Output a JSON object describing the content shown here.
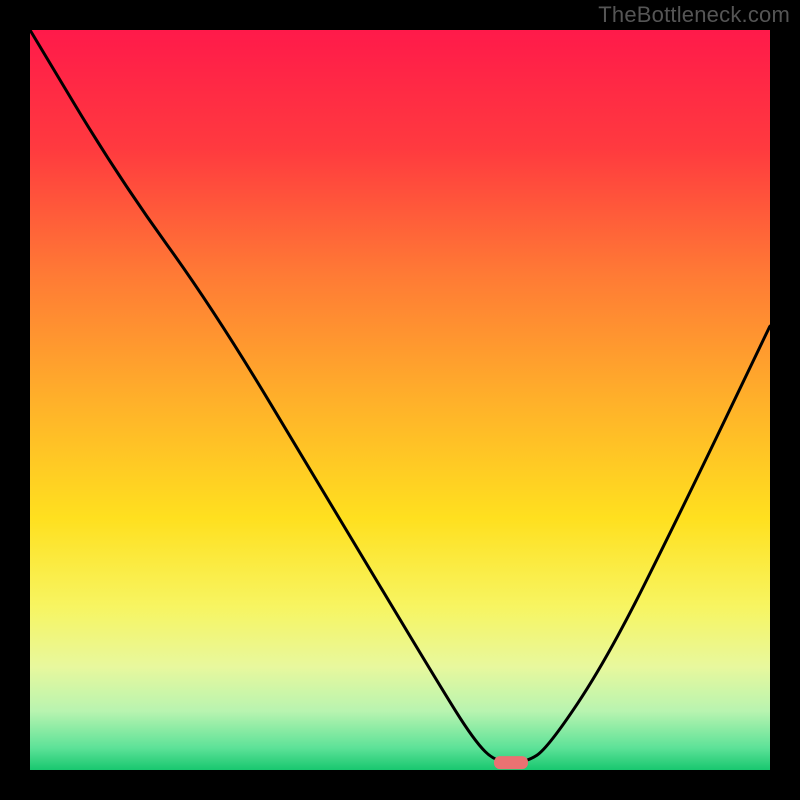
{
  "watermark": "TheBottleneck.com",
  "chart_data": {
    "type": "line",
    "title": "",
    "xlabel": "",
    "ylabel": "",
    "xlim": [
      0,
      100
    ],
    "ylim": [
      0,
      100
    ],
    "grid": false,
    "series": [
      {
        "name": "bottleneck-curve",
        "x": [
          0,
          12,
          25,
          40,
          55,
          60,
          63,
          67,
          70,
          78,
          88,
          100
        ],
        "values": [
          100,
          80,
          62,
          37,
          12,
          4,
          1,
          1,
          3,
          15,
          35,
          60
        ]
      }
    ],
    "optimal_marker": {
      "x": 65,
      "y": 1,
      "color": "#e97272"
    },
    "background": {
      "type": "vertical-gradient",
      "stops": [
        {
          "pos": 0.0,
          "color": "#ff1a4a"
        },
        {
          "pos": 0.16,
          "color": "#ff3a3f"
        },
        {
          "pos": 0.33,
          "color": "#ff7a35"
        },
        {
          "pos": 0.5,
          "color": "#ffb02a"
        },
        {
          "pos": 0.66,
          "color": "#ffe01f"
        },
        {
          "pos": 0.78,
          "color": "#f7f562"
        },
        {
          "pos": 0.86,
          "color": "#e8f89d"
        },
        {
          "pos": 0.92,
          "color": "#b9f4b0"
        },
        {
          "pos": 0.97,
          "color": "#5de298"
        },
        {
          "pos": 1.0,
          "color": "#18c76f"
        }
      ]
    }
  }
}
